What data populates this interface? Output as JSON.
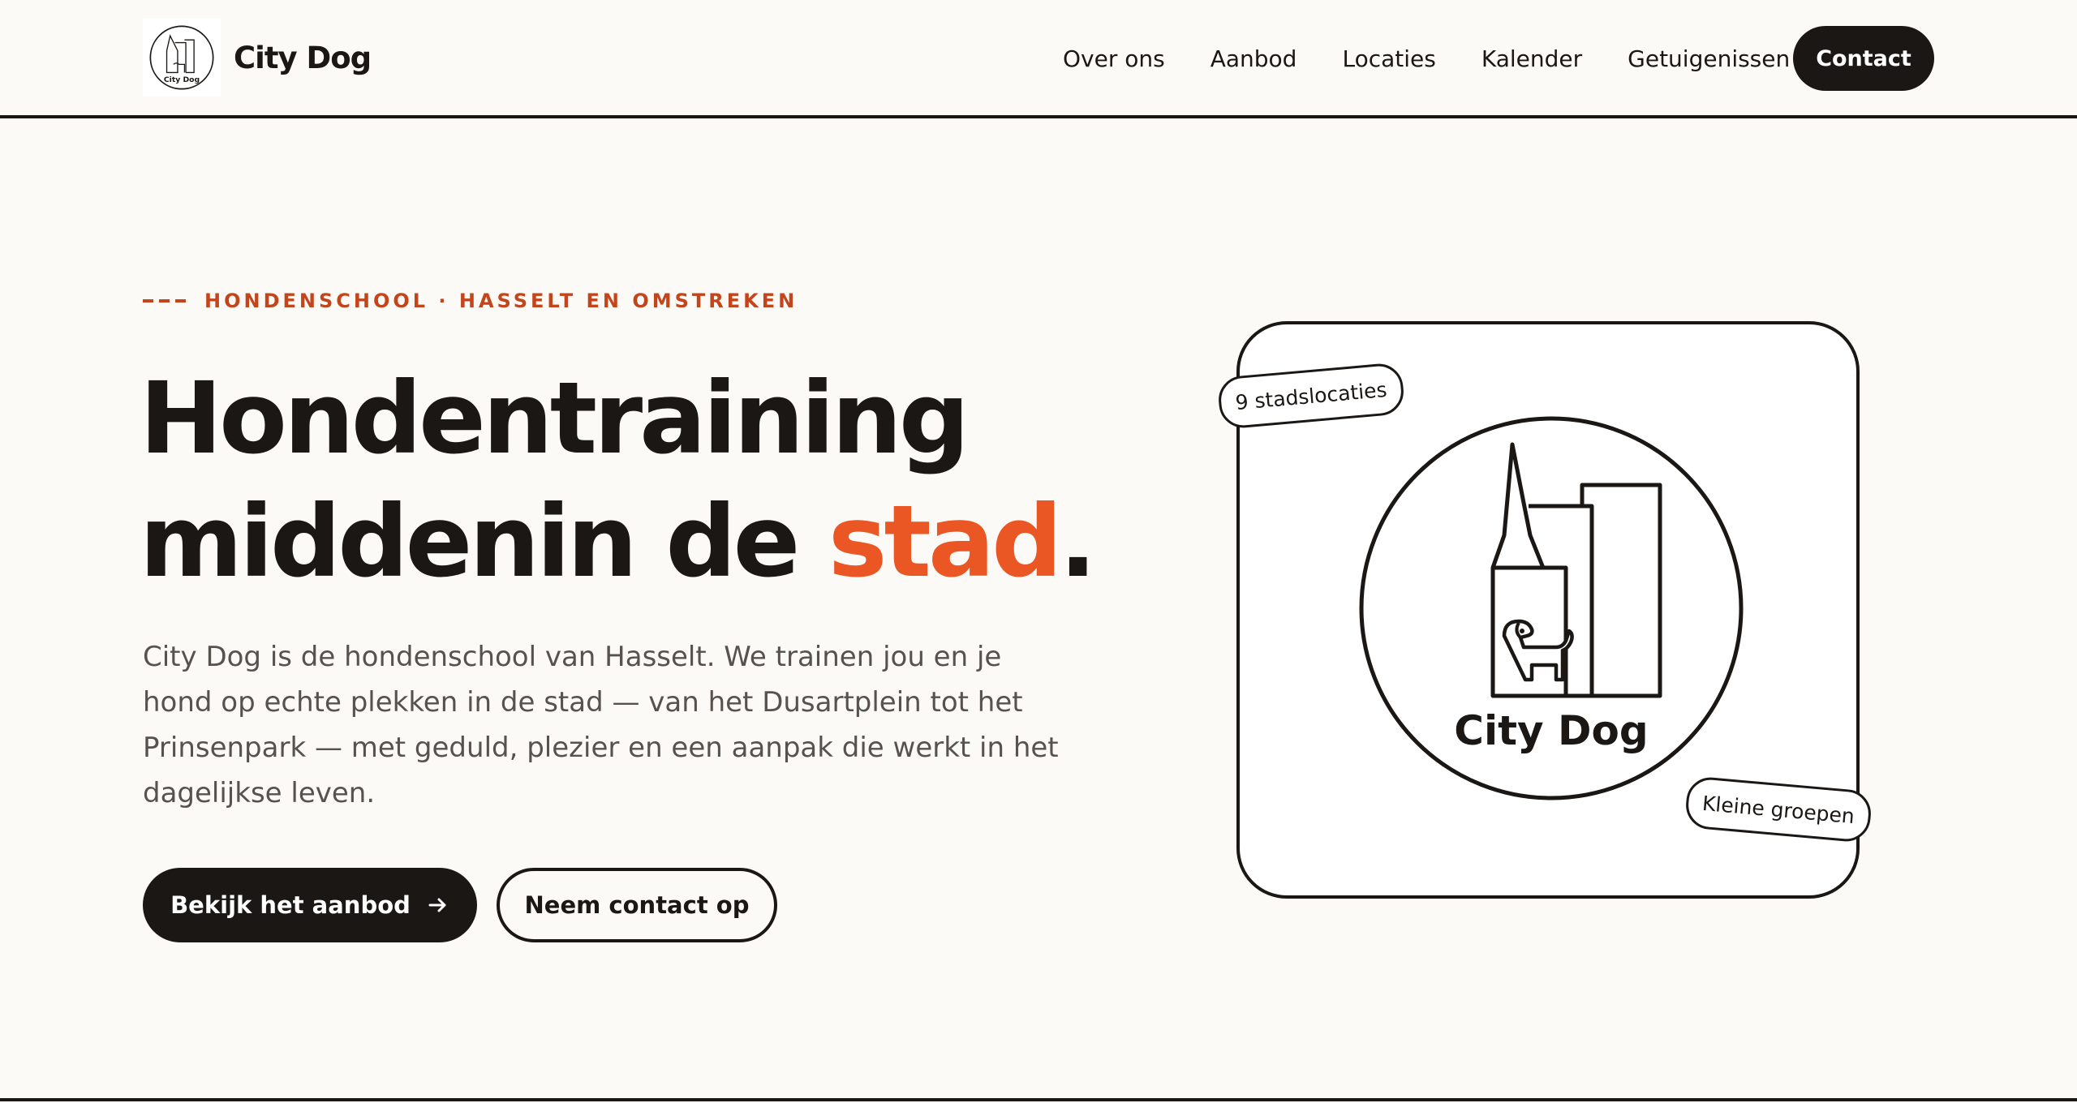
{
  "header": {
    "brand_name": "City Dog",
    "logo_text": "City Dog",
    "nav": [
      "Over ons",
      "Aanbod",
      "Locaties",
      "Kalender",
      "Getuigenissen"
    ],
    "contact_label": "Contact"
  },
  "hero": {
    "eyebrow": "HONDENSCHOOL · HASSELT EN OMSTREKEN",
    "headline_line1": "Hondentraining",
    "headline_line2_start": "middenin de ",
    "headline_accent": "stad",
    "headline_end": ".",
    "lead": "City Dog is de hondenschool van Hasselt. We trainen jou en je hond op echte plekken in de stad — van het Dusartplein tot het Prinsenpark — met geduld, plezier en een aanpak die werkt in het dagelijkse leven.",
    "primary_cta": "Bekijk het aanbod",
    "secondary_cta": "Neem contact op"
  },
  "card": {
    "logo_text": "City Dog",
    "tag_locations": "9 stadslocaties",
    "tag_groups": "Kleine groepen"
  },
  "colors": {
    "background": "#fbfaf6",
    "ink": "#1a1714",
    "accent": "#ea5624",
    "eyebrow": "#c2451c",
    "body_text": "#57524d"
  }
}
